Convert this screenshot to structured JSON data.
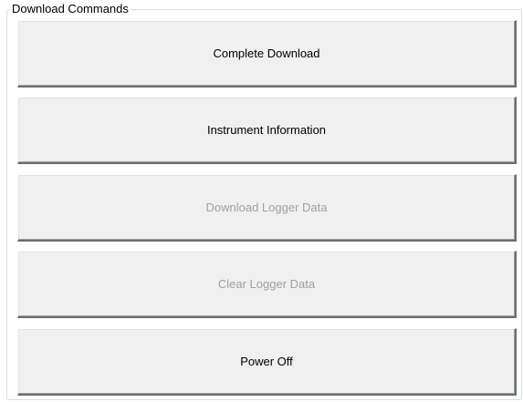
{
  "group": {
    "title": "Download Commands"
  },
  "buttons": [
    {
      "label": "Complete Download",
      "enabled": true
    },
    {
      "label": "Instrument Information",
      "enabled": true
    },
    {
      "label": "Download Logger Data",
      "enabled": false
    },
    {
      "label": "Clear Logger Data",
      "enabled": false
    },
    {
      "label": "Power Off",
      "enabled": true
    }
  ],
  "colors": {
    "button_face": "#f0f0f0",
    "disabled_text": "#a0a0a0",
    "enabled_text": "#000000",
    "groupbox_border": "#d5dfe5"
  }
}
